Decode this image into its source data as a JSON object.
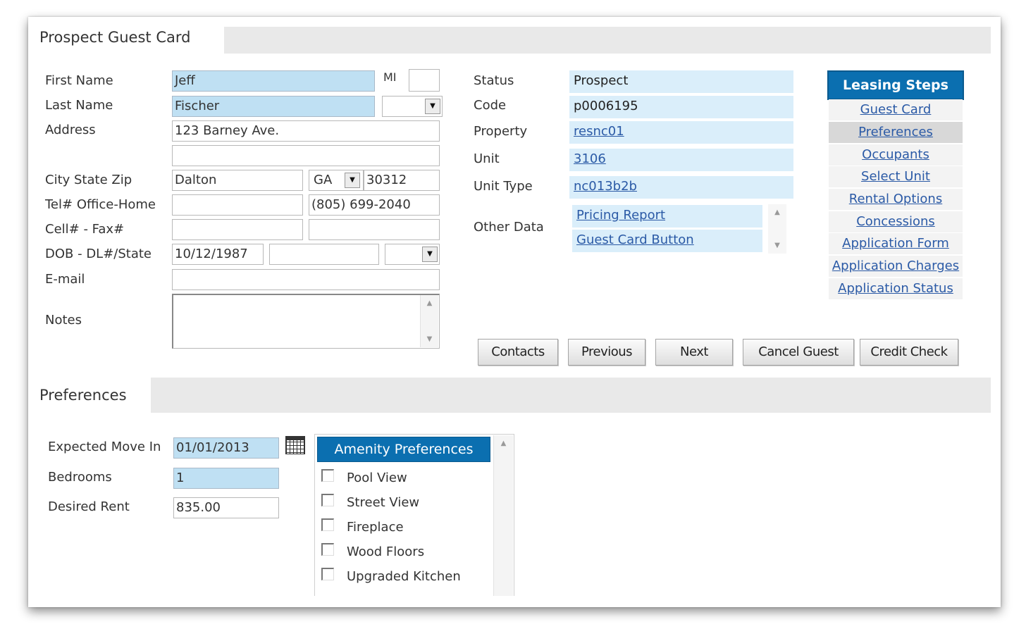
{
  "guest_card": {
    "title": "Prospect Guest Card",
    "labels": {
      "first_name": "First Name",
      "mi": "MI",
      "last_name": "Last Name",
      "address": "Address",
      "city_state_zip": "City State Zip",
      "tel_office_home": "Tel# Office-Home",
      "cell_fax": "Cell# - Fax#",
      "dob_dl_state": "DOB - DL#/State",
      "email": "E-mail",
      "notes": "Notes"
    },
    "values": {
      "first_name": "Jeff",
      "mi": "",
      "last_name": "Fischer",
      "suffix": "",
      "address1": "123 Barney Ave.",
      "address2": "",
      "city": "Dalton",
      "state": "GA",
      "zip": "30312",
      "tel_office": "",
      "tel_home": "(805) 699-2040",
      "cell": "",
      "fax": "",
      "dob": "10/12/1987",
      "dl_number": "",
      "dl_state": "",
      "email": "",
      "notes": ""
    }
  },
  "info": {
    "labels": {
      "status": "Status",
      "code": "Code",
      "property": "Property",
      "unit": "Unit",
      "unit_type": "Unit Type",
      "other_data": "Other Data"
    },
    "values": {
      "status": "Prospect",
      "code": "p0006195",
      "property": "resnc01",
      "unit": "3106",
      "unit_type": "nc013b2b"
    },
    "other_data_items": [
      "Pricing Report",
      "Guest Card Button"
    ]
  },
  "leasing_steps": {
    "title": "Leasing Steps",
    "items": [
      "Guest Card",
      "Preferences",
      "Occupants",
      "Select Unit",
      "Rental Options",
      "Concessions",
      "Application Form",
      "Application Charges",
      "Application Status"
    ],
    "active_index": 1
  },
  "buttons": {
    "contacts": "Contacts",
    "previous": "Previous",
    "next": "Next",
    "cancel_guest": "Cancel Guest",
    "credit_check": "Credit Check"
  },
  "preferences": {
    "title": "Preferences",
    "labels": {
      "expected_move_in": "Expected Move In",
      "bedrooms": "Bedrooms",
      "desired_rent": "Desired Rent"
    },
    "values": {
      "expected_move_in": "01/01/2013",
      "bedrooms": "1",
      "desired_rent": "835.00"
    },
    "amenity_title": "Amenity Preferences",
    "amenities": [
      {
        "label": "Pool View",
        "checked": false
      },
      {
        "label": "Street View",
        "checked": false
      },
      {
        "label": "Fireplace",
        "checked": false
      },
      {
        "label": "Wood Floors",
        "checked": false
      },
      {
        "label": "Upgraded Kitchen",
        "checked": false
      }
    ]
  },
  "icons": {
    "calendar": "calendar-icon",
    "dropdown": "chevron-down-icon",
    "scroll_up": "scroll-up-icon",
    "scroll_down": "scroll-down-icon"
  },
  "colors": {
    "accent": "#0b6fb0",
    "field_highlight": "#bfe0f3",
    "info_background": "#daeefa",
    "link": "#2b5aa6",
    "section_bar": "#e9e9e9"
  }
}
